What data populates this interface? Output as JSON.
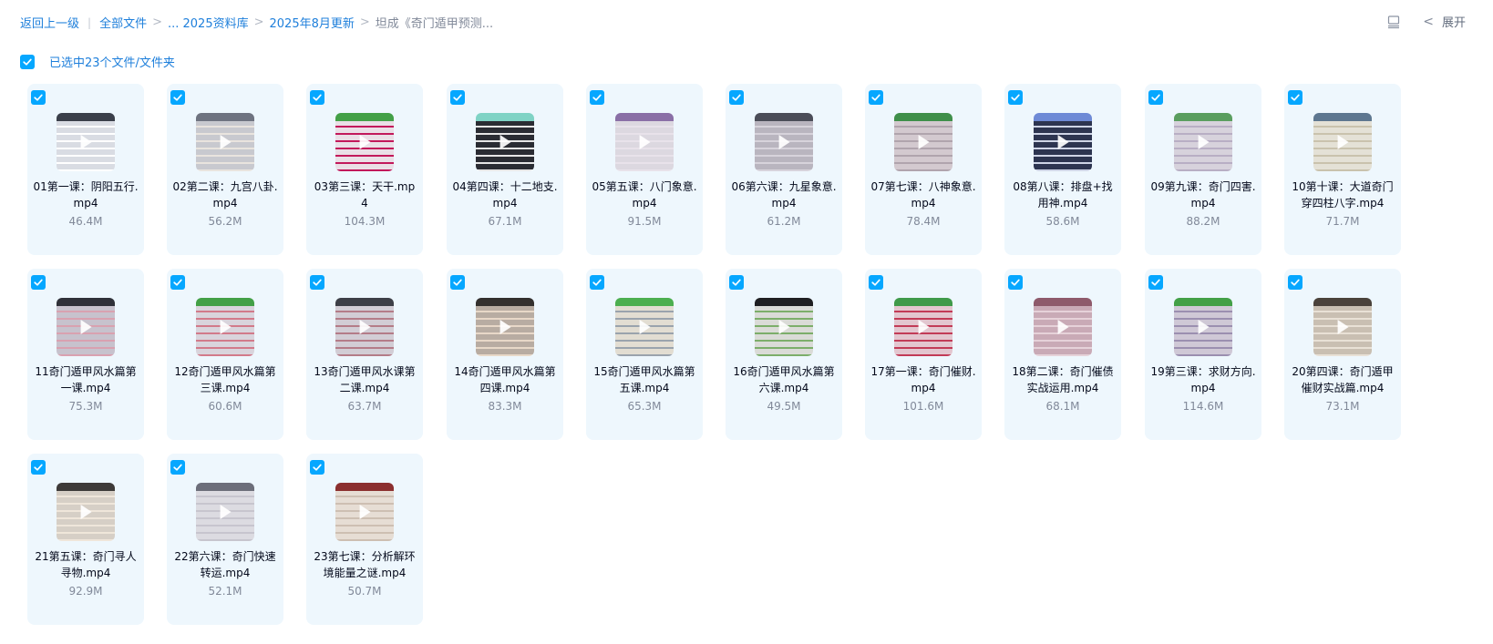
{
  "breadcrumb": {
    "back": "返回上一级",
    "all": "全部文件",
    "level1": "... 2025资料库",
    "level2": "2025年8月更新",
    "current": "坦成《奇门遁甲预测..."
  },
  "toolbar": {
    "view_icon": "list-view-icon",
    "expand_label": "展开"
  },
  "selection": {
    "text": "已选中23个文件/文件夹"
  },
  "colors": {
    "accent": "#06a7ff",
    "link": "#1e7fdb",
    "card_bg": "#eef7fd",
    "muted": "#818999"
  },
  "files": [
    {
      "name": "01第一课：阴阳五行.mp4",
      "size": "46.4M",
      "thumb": {
        "bg": "#d9dce3",
        "bar": "#3a3f4a",
        "accent": "#ffffff"
      }
    },
    {
      "name": "02第二课：九宫八卦.mp4",
      "size": "56.2M",
      "thumb": {
        "bg": "#c8c9cf",
        "bar": "#6e7380",
        "accent": "#e9e4de"
      }
    },
    {
      "name": "03第三课：天干.mp4",
      "size": "104.3M",
      "thumb": {
        "bg": "#eadfe6",
        "bar": "#43a047",
        "accent": "#c2185b"
      }
    },
    {
      "name": "04第四课：十二地支.mp4",
      "size": "67.1M",
      "thumb": {
        "bg": "#2a2c33",
        "bar": "#7fd3c5",
        "accent": "#e6e6e6"
      }
    },
    {
      "name": "05第五课：八门象意.mp4",
      "size": "91.5M",
      "thumb": {
        "bg": "#dcd8e0",
        "bar": "#8a6fa6",
        "accent": "#e8e2ea"
      }
    },
    {
      "name": "06第六课：九星象意.mp4",
      "size": "61.2M",
      "thumb": {
        "bg": "#b9b5bf",
        "bar": "#4b4d58",
        "accent": "#d7d3db"
      }
    },
    {
      "name": "07第七课：八神象意.mp4",
      "size": "78.4M",
      "thumb": {
        "bg": "#d3c9cf",
        "bar": "#3f8f4a",
        "accent": "#b0a4ad"
      }
    },
    {
      "name": "08第八课：排盘+找用神.mp4",
      "size": "58.6M",
      "thumb": {
        "bg": "#2d3550",
        "bar": "#6e8ad6",
        "accent": "#cfd5e6"
      }
    },
    {
      "name": "09第九课：奇门四害.mp4",
      "size": "88.2M",
      "thumb": {
        "bg": "#d7d2dc",
        "bar": "#5a9e5f",
        "accent": "#b8aec4"
      }
    },
    {
      "name": "10第十课：大道奇门穿四柱八字.mp4",
      "size": "71.7M",
      "thumb": {
        "bg": "#e4e1d6",
        "bar": "#5e7790",
        "accent": "#c9c2ad"
      }
    },
    {
      "name": "11奇门遁甲风水篇第一课.mp4",
      "size": "75.3M",
      "thumb": {
        "bg": "#c7c2cd",
        "bar": "#2f3139",
        "accent": "#d9a1b0"
      }
    },
    {
      "name": "12奇门遁甲风水篇第三课.mp4",
      "size": "60.6M",
      "thumb": {
        "bg": "#d9d4dc",
        "bar": "#43a047",
        "accent": "#d27a8a"
      }
    },
    {
      "name": "13奇门遁甲风水课第二课.mp4",
      "size": "63.7M",
      "thumb": {
        "bg": "#d2cdd5",
        "bar": "#3d3f47",
        "accent": "#b47c88"
      }
    },
    {
      "name": "14奇门遁甲风水篇第四课.mp4",
      "size": "83.3M",
      "thumb": {
        "bg": "#b8aca2",
        "bar": "#33302e",
        "accent": "#e8d8c8"
      }
    },
    {
      "name": "15奇门遁甲风水篇第五课.mp4",
      "size": "65.3M",
      "thumb": {
        "bg": "#e2ddd2",
        "bar": "#4caf50",
        "accent": "#9aa3ad"
      }
    },
    {
      "name": "16奇门遁甲风水篇第六课.mp4",
      "size": "49.5M",
      "thumb": {
        "bg": "#dadbd7",
        "bar": "#1f1f22",
        "accent": "#7cae6a"
      }
    },
    {
      "name": "17第一课：奇门催财.mp4",
      "size": "101.6M",
      "thumb": {
        "bg": "#e3c6cf",
        "bar": "#3f9a4a",
        "accent": "#c23b57"
      }
    },
    {
      "name": "18第二课：奇门催债实战运用.mp4",
      "size": "68.1M",
      "thumb": {
        "bg": "#c9aab6",
        "bar": "#8e5a6b",
        "accent": "#e6d2d9"
      }
    },
    {
      "name": "19第三课：求财方向.mp4",
      "size": "114.6M",
      "thumb": {
        "bg": "#cfc8d6",
        "bar": "#43a047",
        "accent": "#9b8fb0"
      }
    },
    {
      "name": "20第四课：奇门遁甲催财实战篇.mp4",
      "size": "73.1M",
      "thumb": {
        "bg": "#c9bfb2",
        "bar": "#4a423b",
        "accent": "#e9e1d6"
      }
    },
    {
      "name": "21第五课：奇门寻人寻物.mp4",
      "size": "92.9M",
      "thumb": {
        "bg": "#d6cfc6",
        "bar": "#3d3a38",
        "accent": "#efe6da"
      }
    },
    {
      "name": "22第六课：奇门快速转运.mp4",
      "size": "52.1M",
      "thumb": {
        "bg": "#dcdbe1",
        "bar": "#6c6e7a",
        "accent": "#c7c5ce"
      }
    },
    {
      "name": "23第七课：分析解环境能量之谜.mp4",
      "size": "50.7M",
      "thumb": {
        "bg": "#e6ddd4",
        "bar": "#8b2f2f",
        "accent": "#cdbfb2"
      }
    }
  ]
}
